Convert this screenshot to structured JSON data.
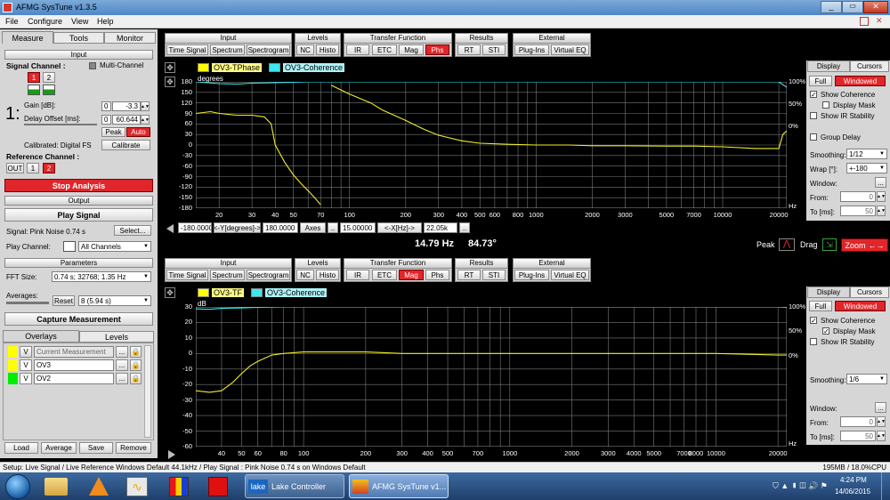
{
  "app": {
    "title": "AFMG SysTune v1.3.5",
    "menu": [
      "File",
      "Configure",
      "View",
      "Help"
    ]
  },
  "colors": {
    "accent_red": "#e0262a",
    "tphase": "#f0ee2c",
    "coherence": "#3ce6f0",
    "ov3": "#ffff00",
    "ov2": "#00ee00",
    "grid": "#8a8a8a",
    "panel": "#d6d6d6"
  },
  "left": {
    "tabs": [
      "Measure",
      "Tools",
      "Monitor"
    ],
    "input": {
      "header": "Input",
      "signal_channel": "Signal Channel :",
      "multi_channel": "Multi-Channel",
      "ch": [
        "1",
        "2"
      ],
      "big_number": "1:",
      "gain_label": "Gain [dB]:",
      "gain_left": "0",
      "gain_value": "-3.3",
      "delay_label": "Delay Offset [ms]:",
      "delay_left": "0",
      "delay_value": "60.644",
      "peak": "Peak",
      "auto": "Auto",
      "calibrated": "Calibrated: Digital FS",
      "calibrate": "Calibrate",
      "reference_channel": "Reference Channel :",
      "ref": [
        "OUT",
        "1",
        "2"
      ]
    },
    "stop_analysis": "Stop Analysis",
    "output": {
      "header": "Output",
      "play_signal": "Play Signal",
      "signal_label": "Signal: Pink Noise  0.74 s",
      "select": "Select...",
      "play_channel": "Play Channel:",
      "all_channels": "All Channels"
    },
    "parameters": {
      "header": "Parameters",
      "fft_label": "FFT Size:",
      "fft_value": "0.74 s; 32768; 1.35 Hz",
      "averages_label": "Averages:",
      "reset": "Reset",
      "averages_value": "8 (5.94 s)"
    },
    "capture": "Capture Measurement",
    "overlay_tabs": [
      "Overlays",
      "Levels"
    ],
    "overlays": [
      {
        "v": "V",
        "name": "Current Measurement",
        "color": "#ffff00"
      },
      {
        "v": "V",
        "name": "OV3",
        "color": "#ffff00"
      },
      {
        "v": "V",
        "name": "OV2",
        "color": "#00ee00"
      }
    ],
    "overlay_buttons": [
      "Load",
      "Average",
      "Save",
      "Remove"
    ]
  },
  "toolbar": {
    "groups": [
      "Input",
      "Levels",
      "Transfer Function",
      "Results",
      "External"
    ],
    "input": [
      "Time Signal",
      "Spectrum",
      "Spectrogram"
    ],
    "levels": [
      "NC",
      "Histo"
    ],
    "tf": [
      "IR",
      "ETC",
      "Mag",
      "Phs"
    ],
    "results": [
      "RT",
      "STI"
    ],
    "external": [
      "Plug-Ins",
      "Virtual EQ"
    ]
  },
  "top_graph": {
    "legend": [
      "OV3-TPhase",
      "OV3-Coherence"
    ],
    "unit": "degrees",
    "hz": "Hz",
    "y_ticks": [
      "180",
      "150",
      "120",
      "90",
      "60",
      "30",
      "0",
      "-30",
      "-60",
      "-90",
      "-120",
      "-150",
      "-180"
    ],
    "x_ticks": [
      "20",
      "30",
      "40",
      "50",
      "70",
      "100",
      "200",
      "300",
      "400",
      "500",
      "600",
      "800",
      "1000",
      "2000",
      "3000",
      "5000",
      "7000",
      "10000",
      "20000"
    ],
    "coh_ticks": [
      "100%",
      "50%",
      "0%"
    ],
    "axis_controls": {
      "ymin": "-180.0000",
      "ylabel": "<-Y[degrees]->",
      "ymax": "180.0000",
      "axes": "Axes",
      "dots": "..",
      "xmin": "15.00000",
      "xlabel": "<-X[Hz]->",
      "xmax": "22.05k"
    }
  },
  "readout": {
    "freq": "14.79 Hz",
    "value": "84.73°",
    "peak": "Peak",
    "drag": "Drag",
    "zoom": "Zoom"
  },
  "bottom_graph": {
    "legend": [
      "OV3-TF",
      "OV3-Coherence"
    ],
    "unit": "dB",
    "hz": "Hz",
    "y_ticks": [
      "30",
      "20",
      "10",
      "0",
      "-10",
      "-20",
      "-30",
      "-40",
      "-50",
      "-60"
    ],
    "x_ticks": [
      "40",
      "50",
      "60",
      "80",
      "100",
      "200",
      "300",
      "400",
      "500",
      "700",
      "1000",
      "2000",
      "3000",
      "4000",
      "5000",
      "7000",
      "8000",
      "10000",
      "20000"
    ],
    "coh_ticks": [
      "100%",
      "50%",
      "0%"
    ]
  },
  "side_top": {
    "tabs": [
      "Display",
      "Cursors"
    ],
    "full": "Full",
    "windowed": "Windowed",
    "show_coherence": "Show Coherence",
    "display_mask": "Display Mask",
    "show_ir": "Show IR Stability",
    "group_delay": "Group Delay",
    "smoothing_label": "Smoothing:",
    "smoothing": "1/12",
    "wrap_label": "Wrap [°]:",
    "wrap": "+-180",
    "window_label": "Window:",
    "from_label": "From:",
    "from": "0",
    "to_label": "To [ms]:",
    "to": "50"
  },
  "side_bottom": {
    "tabs": [
      "Display",
      "Cursors"
    ],
    "full": "Full",
    "windowed": "Windowed",
    "show_coherence": "Show Coherence",
    "display_mask": "Display Mask",
    "show_ir": "Show IR Stability",
    "smoothing_label": "Smoothing:",
    "smoothing": "1/6",
    "window_label": "Window:",
    "from_label": "From:",
    "from": "0",
    "to_label": "To [ms]:",
    "to": "50"
  },
  "status": {
    "left": "Setup: Live Signal / Live Reference Windows Default 44.1kHz / Play Signal : Pink Noise  0.74 s on Windows Default",
    "right": "195MB / 18.0%CPU"
  },
  "taskbar": {
    "lake": "Lake Controller",
    "systune": "AFMG SysTune v1...",
    "time": "4:24 PM",
    "date": "14/06/2015"
  },
  "chart_data": [
    {
      "type": "line",
      "title": "",
      "ylabel": "degrees",
      "xlabel": "Hz",
      "x_scale": "log",
      "xlim": [
        15,
        22050
      ],
      "ylim": [
        -180,
        180
      ],
      "grid": true,
      "legend": "top-left",
      "series": [
        {
          "name": "OV3-TPhase",
          "x": [
            15,
            18,
            20,
            25,
            30,
            35,
            38,
            40,
            45,
            50,
            55,
            60,
            65,
            70
          ],
          "y": [
            90,
            95,
            90,
            85,
            85,
            80,
            60,
            0,
            -50,
            -85,
            -110,
            -130,
            -150,
            -170
          ]
        },
        {
          "name": "OV3-TPhase",
          "x": [
            80,
            100,
            130,
            150,
            200,
            250,
            300,
            400,
            500,
            700,
            1000,
            1500,
            2000,
            3000,
            5000,
            7000,
            10000,
            15000,
            20000,
            21000,
            22000
          ],
          "y": [
            170,
            145,
            120,
            100,
            70,
            45,
            28,
            12,
            5,
            2,
            0,
            0,
            -2,
            -2,
            -3,
            -3,
            -5,
            -10,
            -10,
            30,
            40
          ]
        },
        {
          "name": "OV3-Coherence",
          "x": [
            15,
            20,
            25,
            30,
            40,
            50,
            60,
            80,
            100,
            200,
            500,
            1000,
            5000,
            10000,
            20000,
            22000
          ],
          "y": [
            100,
            96,
            95,
            97,
            98,
            99,
            100,
            100,
            100,
            100,
            100,
            100,
            100,
            100,
            100,
            88
          ]
        }
      ]
    },
    {
      "type": "line",
      "title": "",
      "ylabel": "dB",
      "xlabel": "Hz",
      "x_scale": "log",
      "xlim": [
        30,
        22050
      ],
      "ylim": [
        -60,
        30
      ],
      "grid": true,
      "legend": "top-left",
      "series": [
        {
          "name": "OV3-TF",
          "x": [
            30,
            35,
            40,
            45,
            50,
            55,
            60,
            70,
            80,
            100,
            150,
            200,
            300,
            500,
            1000,
            2000,
            5000,
            10000,
            20000,
            22000
          ],
          "y": [
            -24,
            -25,
            -24,
            -19,
            -13,
            -8,
            -5,
            -1,
            0,
            1,
            1,
            1,
            0,
            0,
            0,
            0,
            0,
            0,
            -1,
            -1
          ]
        },
        {
          "name": "OV3-Coherence",
          "x": [
            30,
            35,
            40,
            50,
            60,
            80,
            100,
            200,
            1000,
            10000,
            20000,
            22000
          ],
          "y": [
            96,
            95,
            97,
            98,
            99,
            100,
            100,
            100,
            100,
            100,
            100,
            99
          ]
        }
      ]
    }
  ]
}
